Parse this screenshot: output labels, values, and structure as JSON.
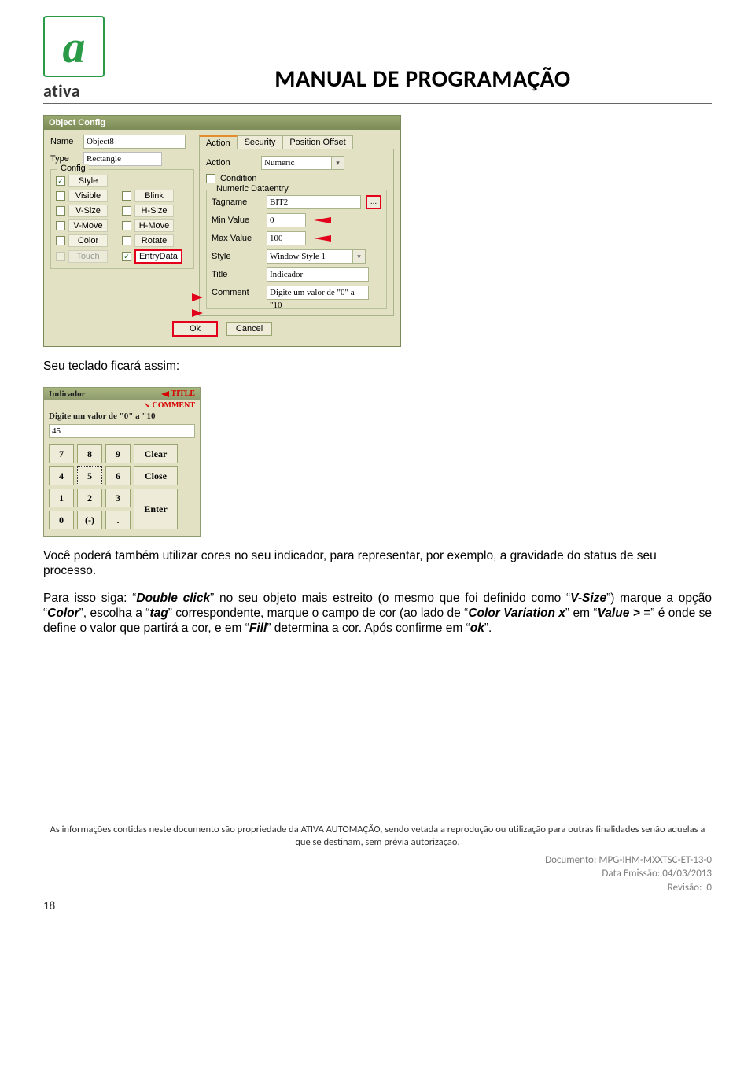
{
  "logo": {
    "glyph": "a",
    "text": "ativa"
  },
  "page_title": "MANUAL DE PROGRAMAÇÃO",
  "object_config": {
    "window_title": "Object Config",
    "name_label": "Name",
    "name_value": "Object8",
    "type_label": "Type",
    "type_value": "Rectangle",
    "config_group": "Config",
    "config_items": {
      "style": "Style",
      "visible": "Visible",
      "blink": "Blink",
      "vsize": "V-Size",
      "hsize": "H-Size",
      "vmove": "V-Move",
      "hmove": "H-Move",
      "color": "Color",
      "rotate": "Rotate",
      "touch": "Touch",
      "entrydata": "EntryData"
    },
    "tabs": {
      "action": "Action",
      "security": "Security",
      "position": "Position Offset"
    },
    "action_label": "Action",
    "action_value": "Numeric",
    "condition_label": "Condition",
    "dataentry_group": "Numeric Dataentry",
    "tagname_label": "Tagname",
    "tagname_value": "BIT2",
    "browse": "...",
    "min_label": "Min Value",
    "min_value": "0",
    "max_label": "Max Value",
    "max_value": "100",
    "style_label": "Style",
    "style_value": "Window Style 1",
    "title_label": "Title",
    "title_value": "Indicador",
    "comment_label": "Comment",
    "comment_value": "Digite um valor de \"0\" a \"10",
    "ok": "Ok",
    "cancel": "Cancel"
  },
  "para1": "Seu teclado ficará assim:",
  "keypad": {
    "title": "Indicador",
    "title_ann": "TITLE",
    "comment_ann": "COMMENT",
    "comment": "Digite um valor de \"0\" a \"10",
    "display": "45",
    "keys": [
      "7",
      "8",
      "9",
      "Clear",
      "4",
      "5",
      "6",
      "Close",
      "1",
      "2",
      "3",
      "Enter",
      "0",
      "(-)",
      "."
    ]
  },
  "para2": {
    "l1a": "Você poderá também utilizar cores no seu indicador, para representar, por exemplo, a gravidade do status de seu processo.",
    "l2a": "Para isso siga: “",
    "l2b": "Double click",
    "l2c": "” no seu objeto mais estreito (o mesmo que foi definido como “",
    "l2d": "V-Size",
    "l2e": "”) marque a opção “",
    "l2f": "Color",
    "l2g": "”, escolha a “",
    "l2h": "tag",
    "l2i": "” correspondente, marque o campo de cor (ao lado de “",
    "l2j": "Color Variation x",
    "l2k": "” em “",
    "l2l": "Value > =",
    "l2m": "” é onde se define o valor que partirá a cor, e em “",
    "l2n": "Fill",
    "l2o": "” determina a cor. Após confirme em “",
    "l2p": "ok",
    "l2q": "”."
  },
  "footer_note": "As informações contidas neste documento são propriedade da ATIVA AUTOMAÇÃO, sendo vetada a reprodução ou utilização para outras finalidades senão aquelas a que se destinam, sem prévia autorização.",
  "doc_meta": {
    "doc_label": "Documento:",
    "doc_value": "MPG-IHM-MXXTSC-ET-13-0",
    "date_label": "Data Emissão:",
    "date_value": "04/03/2013",
    "rev_label": "Revisão:",
    "rev_value": "0"
  },
  "page_number": "18"
}
